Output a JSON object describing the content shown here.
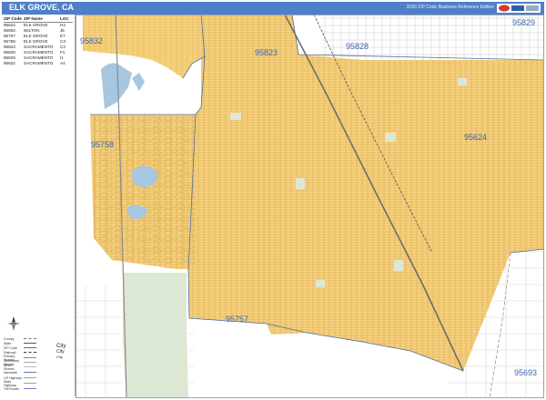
{
  "header": {
    "title": "ELK GROVE, CA",
    "subtitle": "2020 ZIP Code Business Reference Edition"
  },
  "zip_table": {
    "headers": [
      "ZIP Code",
      "ZIP Name",
      "LOC"
    ],
    "rows": [
      [
        "95624",
        "ELK GROVE",
        "H4"
      ],
      [
        "95693",
        "WILTON",
        "J5"
      ],
      [
        "95757",
        "ELK GROVE",
        "E7"
      ],
      [
        "95758",
        "ELK GROVE",
        "C3"
      ],
      [
        "95823",
        "SACRAMENTO",
        "C2"
      ],
      [
        "95828",
        "SACRAMENTO",
        "F1"
      ],
      [
        "95829",
        "SACRAMENTO",
        "I1"
      ],
      [
        "95832",
        "SACRAMENTO",
        "A4"
      ]
    ]
  },
  "map": {
    "zip_labels": [
      "95832",
      "95828",
      "95829",
      "95823",
      "95758",
      "95624",
      "95757",
      "95693"
    ],
    "colors": {
      "zip_area": "#f9d37e",
      "outside": "#ffffff",
      "outside_street": "#c9c9c9",
      "zip_street": "#c89a48",
      "water": "#a7c7e0",
      "park": "#dde8d4",
      "zip_boundary": "#4e6f9f",
      "highway": "#6d6d6d",
      "title_bar": "#4f7fc9"
    }
  },
  "legend": {
    "items": [
      "County",
      "State",
      "ZIP Code",
      "Railroad",
      "Primary Streets",
      "Secondary Streets",
      "Minor Streets",
      "Interstate",
      "US Highway",
      "State Highway",
      "Toll Roads"
    ],
    "city_label": "City"
  }
}
